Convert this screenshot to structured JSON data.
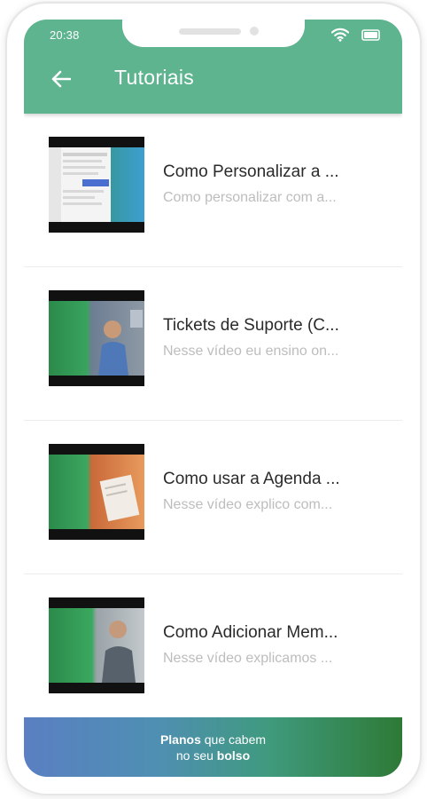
{
  "status_bar": {
    "time": "20:38",
    "icons": [
      "wifi-icon",
      "battery-icon"
    ]
  },
  "header": {
    "back_icon": "arrow-left-icon",
    "title": "Tutoriais",
    "color": "#5db48e"
  },
  "videos": [
    {
      "title": "Como Personalizar a ...",
      "subtitle": "Como personalizar com a..."
    },
    {
      "title": "Tickets de Suporte (C...",
      "subtitle": "Nesse vídeo eu ensino on..."
    },
    {
      "title": "Como usar a Agenda ...",
      "subtitle": "Nesse vídeo explico com..."
    },
    {
      "title": "Como Adicionar Mem...",
      "subtitle": "Nesse vídeo explicamos ..."
    }
  ],
  "banner": {
    "line1_bold": "Planos",
    "line1_rest": " que cabem",
    "line2_rest": "no seu ",
    "line2_bold": "bolso"
  }
}
